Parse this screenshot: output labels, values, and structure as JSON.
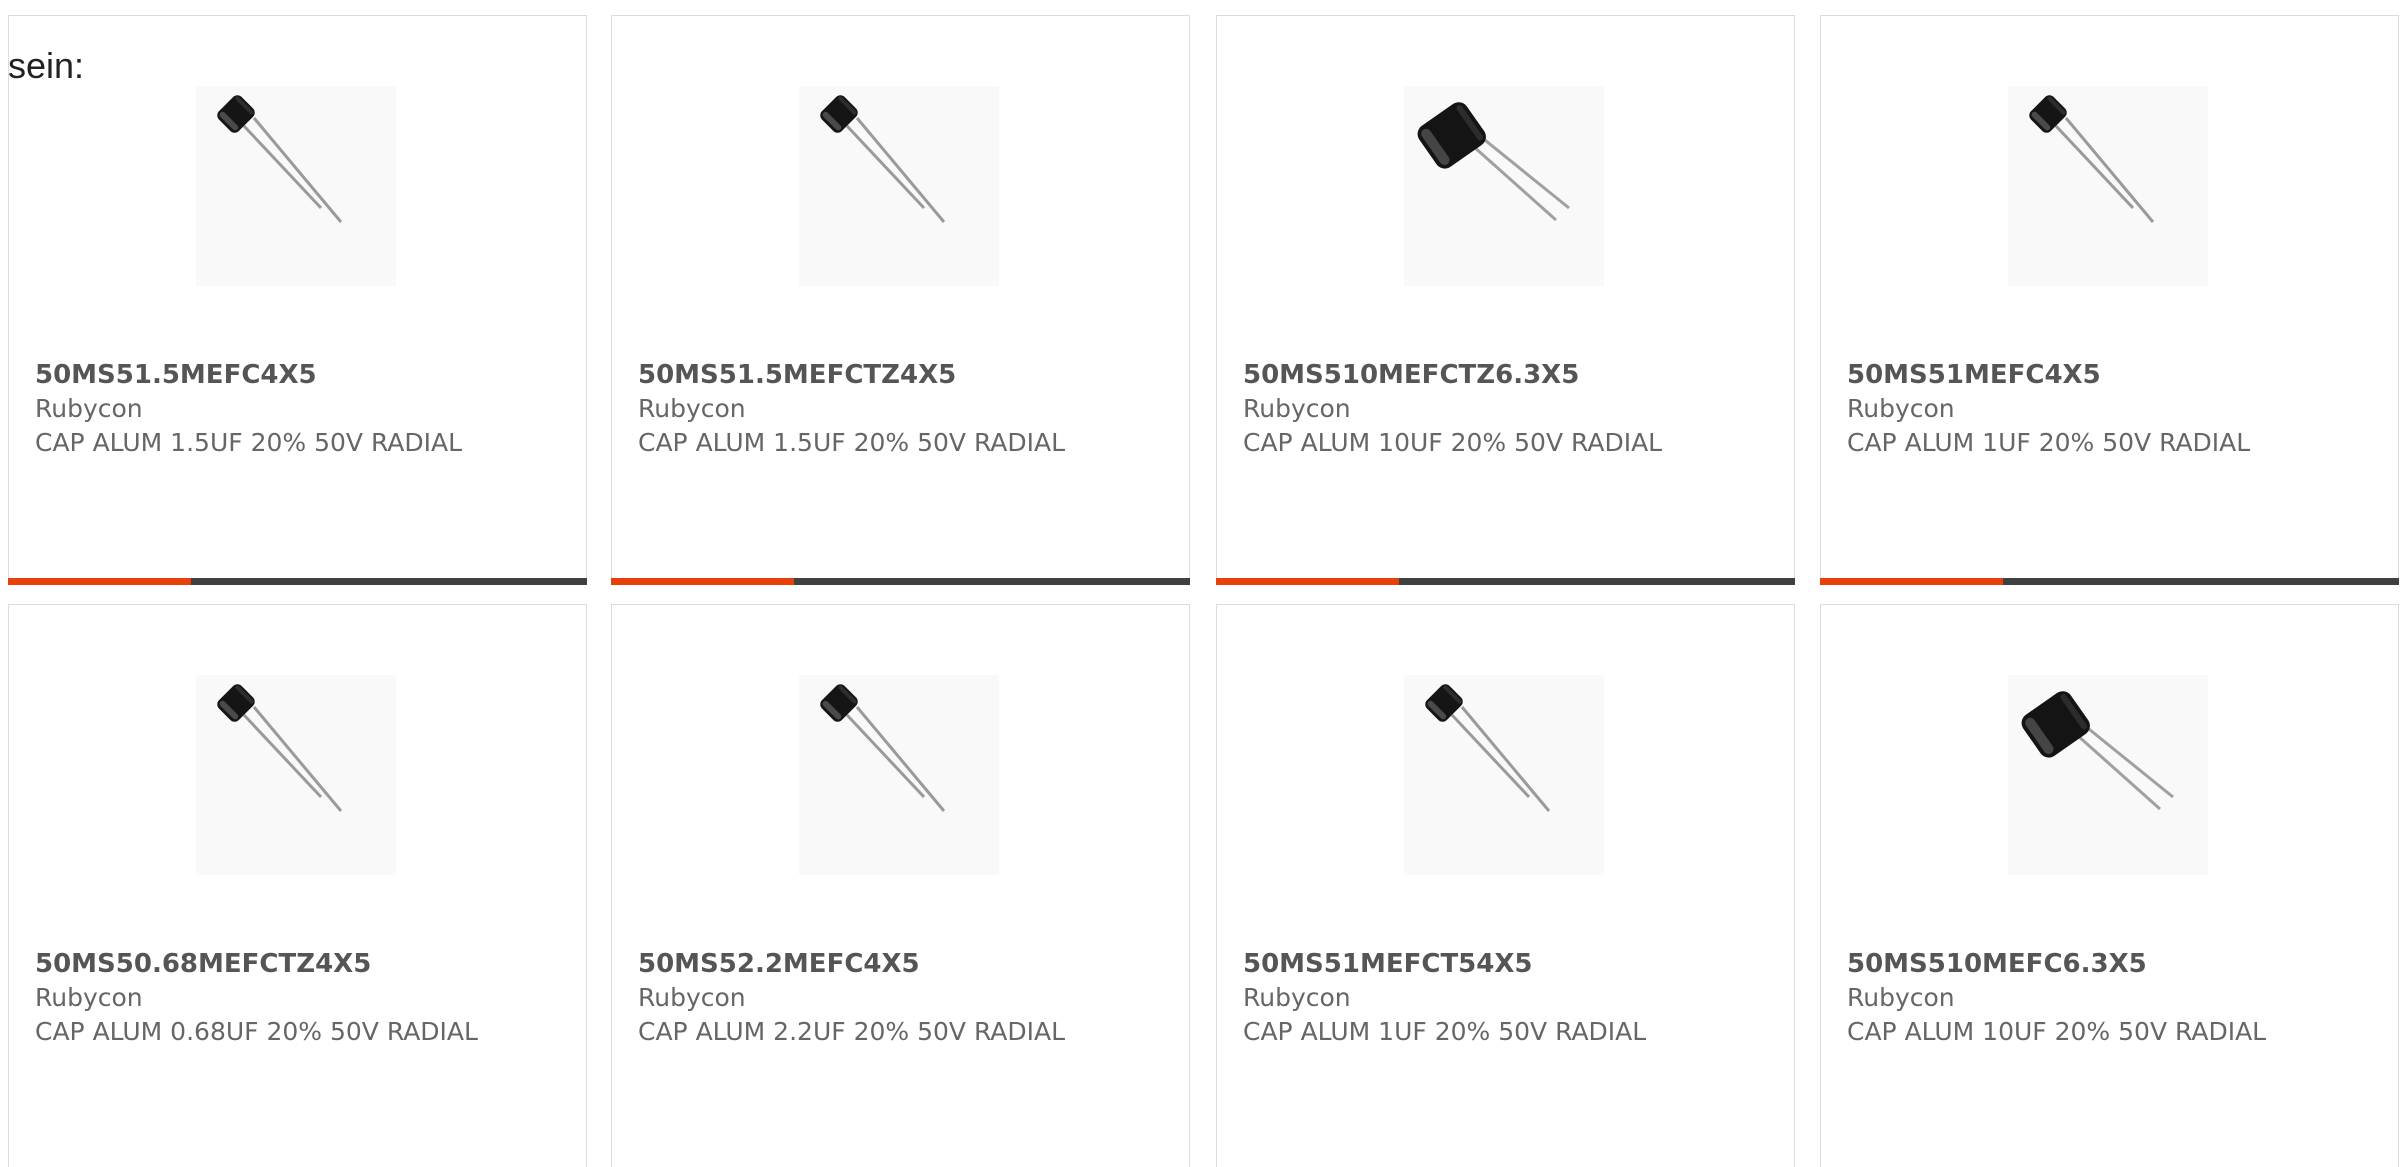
{
  "intro_text": "sein:",
  "colors": {
    "accent": "#e8400a",
    "bar_dark": "#404040",
    "card_border": "#dcdcdc",
    "text": "#666666"
  },
  "products": [
    {
      "part_number": "50MS51.5MEFC4X5",
      "manufacturer": "Rubycon",
      "description": "CAP ALUM 1.5UF 20% 50V RADIAL",
      "image_icon": "radial-capacitor-icon"
    },
    {
      "part_number": "50MS51.5MEFCTZ4X5",
      "manufacturer": "Rubycon",
      "description": "CAP ALUM 1.5UF 20% 50V RADIAL",
      "image_icon": "radial-capacitor-icon"
    },
    {
      "part_number": "50MS510MEFCTZ6.3X5",
      "manufacturer": "Rubycon",
      "description": "CAP ALUM 10UF 20% 50V RADIAL",
      "image_icon": "radial-capacitor-icon"
    },
    {
      "part_number": "50MS51MEFC4X5",
      "manufacturer": "Rubycon",
      "description": "CAP ALUM 1UF 20% 50V RADIAL",
      "image_icon": "radial-capacitor-icon"
    },
    {
      "part_number": "50MS50.68MEFCTZ4X5",
      "manufacturer": "Rubycon",
      "description": "CAP ALUM 0.68UF 20% 50V RADIAL",
      "image_icon": "radial-capacitor-icon"
    },
    {
      "part_number": "50MS52.2MEFC4X5",
      "manufacturer": "Rubycon",
      "description": "CAP ALUM 2.2UF 20% 50V RADIAL",
      "image_icon": "radial-capacitor-icon"
    },
    {
      "part_number": "50MS51MEFCT54X5",
      "manufacturer": "Rubycon",
      "description": "CAP ALUM 1UF 20% 50V RADIAL",
      "image_icon": "radial-capacitor-icon"
    },
    {
      "part_number": "50MS510MEFC6.3X5",
      "manufacturer": "Rubycon",
      "description": "CAP ALUM 10UF 20% 50V RADIAL",
      "image_icon": "radial-capacitor-icon"
    }
  ]
}
